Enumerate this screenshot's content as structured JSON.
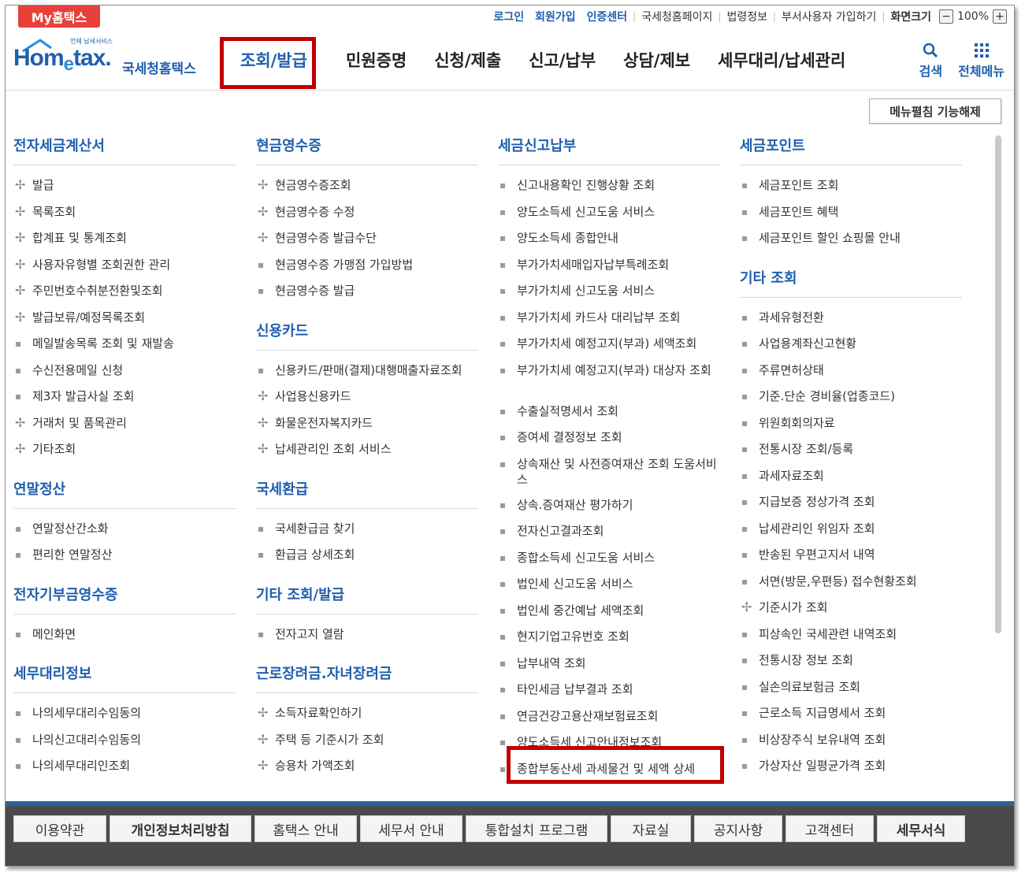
{
  "topbar": {
    "my_tab": "My홈택스",
    "links": [
      "로그인",
      "회원가입",
      "인증센터",
      "국세청홈페이지",
      "법령정보",
      "부서사용자 가입하기",
      "화면크기"
    ],
    "zoom": "100%"
  },
  "header": {
    "logo_small": "언제 납세서비스",
    "logo_main_1": "Hom",
    "logo_main_e": "e",
    "logo_main_2": "tax.",
    "logo_kr": "국세청홈택스",
    "gnb": [
      "조회/발급",
      "민원증명",
      "신청/제출",
      "신고/납부",
      "상담/제보",
      "세무대리/납세관리"
    ],
    "search_label": "검색",
    "allmenu_label": "전체메뉴",
    "accent": "#1f5fae"
  },
  "fold_button": "메뉴펼침 기능해제",
  "columns": [
    [
      {
        "title": "전자세금계산서",
        "items": [
          {
            "t": "발급",
            "p": true
          },
          {
            "t": "목록조회",
            "p": true
          },
          {
            "t": "합계표 및 통계조회",
            "p": true
          },
          {
            "t": "사용자유형별 조회권한 관리",
            "p": true
          },
          {
            "t": "주민번호수취분전환및조회",
            "p": true
          },
          {
            "t": "발급보류/예정목록조회",
            "p": true
          },
          {
            "t": "메일발송목록 조회 및 재발송",
            "p": false
          },
          {
            "t": "수신전용메일 신청",
            "p": false
          },
          {
            "t": "제3자 발급사실 조회",
            "p": false
          },
          {
            "t": "거래처 및 품목관리",
            "p": true
          },
          {
            "t": "기타조회",
            "p": true
          }
        ]
      },
      {
        "title": "연말정산",
        "items": [
          {
            "t": "연말정산간소화",
            "p": false
          },
          {
            "t": "편리한 연말정산",
            "p": false
          }
        ]
      },
      {
        "title": "전자기부금영수증",
        "items": [
          {
            "t": "메인화면",
            "p": false
          }
        ]
      },
      {
        "title": "세무대리정보",
        "items": [
          {
            "t": "나의세무대리수임동의",
            "p": false
          },
          {
            "t": "나의신고대리수임동의",
            "p": false
          },
          {
            "t": "나의세무대리인조회",
            "p": false
          }
        ]
      }
    ],
    [
      {
        "title": "현금영수증",
        "items": [
          {
            "t": "현금영수증조회",
            "p": true
          },
          {
            "t": "현금영수증 수정",
            "p": true
          },
          {
            "t": "현금영수증 발급수단",
            "p": true
          },
          {
            "t": "현금영수증 가맹점 가입방법",
            "p": false
          },
          {
            "t": "현금영수증 발급",
            "p": false
          }
        ]
      },
      {
        "title": "신용카드",
        "items": [
          {
            "t": "신용카드/판매(결제)대행매출자료조회",
            "p": false
          },
          {
            "t": "사업용신용카드",
            "p": true
          },
          {
            "t": "화물운전자복지카드",
            "p": true
          },
          {
            "t": "납세관리인 조회 서비스",
            "p": true
          }
        ]
      },
      {
        "title": "국세환급",
        "items": [
          {
            "t": "국세환급금 찾기",
            "p": false
          },
          {
            "t": "환급금 상세조회",
            "p": false
          }
        ]
      },
      {
        "title": "기타 조회/발급",
        "items": [
          {
            "t": "전자고지 열람",
            "p": false
          }
        ]
      },
      {
        "title": "근로장려금.자녀장려금",
        "items": [
          {
            "t": "소득자료확인하기",
            "p": true
          },
          {
            "t": "주택 등 기준시가 조회",
            "p": true
          },
          {
            "t": "승용차 가액조회",
            "p": true
          }
        ]
      }
    ],
    [
      {
        "title": "세금신고납부",
        "items": [
          {
            "t": "신고내용확인 진행상황 조회",
            "p": false
          },
          {
            "t": "양도소득세 신고도움 서비스",
            "p": false
          },
          {
            "t": "양도소득세 종합안내",
            "p": false
          },
          {
            "t": "부가가치세매입자납부특례조회",
            "p": false
          },
          {
            "t": "부가가치세 신고도움 서비스",
            "p": false
          },
          {
            "t": "부가가치세 카드사 대리납부 조회",
            "p": false
          },
          {
            "t": "부가가치세 예정고지(부과) 세액조회",
            "p": false
          },
          {
            "t": "부가가치세 예정고지(부과) 대상자 조회",
            "p": false
          },
          {
            "t": "수출실적명세서 조회",
            "p": false
          },
          {
            "t": "증여세 결정정보 조회",
            "p": false
          },
          {
            "t": "상속재산 및 사전증여재산 조회 도움서비스",
            "p": false
          },
          {
            "t": "상속.증여재산 평가하기",
            "p": false
          },
          {
            "t": "전자신고결과조회",
            "p": false
          },
          {
            "t": "종합소득세 신고도움 서비스",
            "p": false
          },
          {
            "t": "법인세 신고도움 서비스",
            "p": false
          },
          {
            "t": "법인세 중간예납 세액조회",
            "p": false
          },
          {
            "t": "현지기업고유번호 조회",
            "p": false
          },
          {
            "t": "납부내역 조회",
            "p": false
          },
          {
            "t": "타인세금 납부결과 조회",
            "p": false
          },
          {
            "t": "연금건강고용산재보험료조회",
            "p": false
          },
          {
            "t": "양도소득세 신고안내정보조회",
            "p": false
          },
          {
            "t": "종합부동산세 과세물건 및 세액 상세",
            "p": false
          }
        ]
      }
    ],
    [
      {
        "title": "세금포인트",
        "items": [
          {
            "t": "세금포인트 조회",
            "p": false
          },
          {
            "t": "세금포인트 혜택",
            "p": false
          },
          {
            "t": "세금포인트 할인 쇼핑몰 안내",
            "p": false
          }
        ]
      },
      {
        "title": "기타 조회",
        "items": [
          {
            "t": "과세유형전환",
            "p": false
          },
          {
            "t": "사업용계좌신고현황",
            "p": false
          },
          {
            "t": "주류면허상태",
            "p": false
          },
          {
            "t": "기준.단순 경비율(업종코드)",
            "p": false
          },
          {
            "t": "위원회회의자료",
            "p": false
          },
          {
            "t": "전통시장 조회/등록",
            "p": false
          },
          {
            "t": "과세자료조회",
            "p": false
          },
          {
            "t": "지급보증 정상가격 조회",
            "p": false
          },
          {
            "t": "납세관리인 위임자 조회",
            "p": false
          },
          {
            "t": "반송된 우편고지서 내역",
            "p": false
          },
          {
            "t": "서면(방문,우편등) 접수현황조회",
            "p": false
          },
          {
            "t": "기준시가 조회",
            "p": true
          },
          {
            "t": "피상속인 국세관련 내역조회",
            "p": false
          },
          {
            "t": "전통시장 정보 조회",
            "p": false
          },
          {
            "t": "실손의료보험금 조회",
            "p": false
          },
          {
            "t": "근로소득 지급명세서 조회",
            "p": false
          },
          {
            "t": "비상장주식 보유내역 조회",
            "p": false
          },
          {
            "t": "가상자산 일평균가격 조회",
            "p": false
          }
        ]
      }
    ]
  ],
  "footer": {
    "buttons": [
      "이용약관",
      "개인정보처리방침",
      "홈택스 안내",
      "세무서 안내",
      "통합설치 프로그램",
      "자료실",
      "공지사항",
      "고객센터",
      "세무서식"
    ]
  }
}
